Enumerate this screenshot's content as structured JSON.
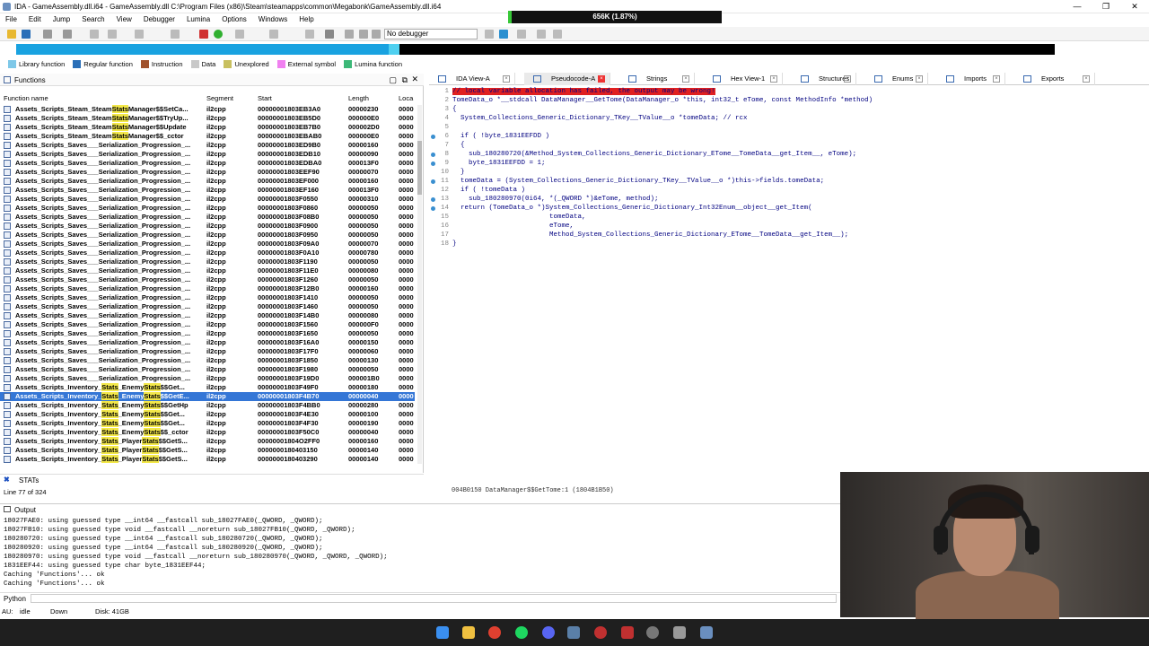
{
  "window": {
    "title": "IDA - GameAssembly.dll.i64 - GameAssembly.dll C:\\Program Files (x86)\\Steam\\steamapps\\common\\Megabonk\\GameAssembly.dll.i64",
    "progress": "656K (1.87%)",
    "progress_fraction": 0.0187
  },
  "menu": [
    "File",
    "Edit",
    "Jump",
    "Search",
    "View",
    "Debugger",
    "Lumina",
    "Options",
    "Windows",
    "Help"
  ],
  "toolbar": {
    "debugger": "No debugger"
  },
  "legend": [
    {
      "label": "Library function",
      "color": "#7ec8e8"
    },
    {
      "label": "Regular function",
      "color": "#2a6fb8"
    },
    {
      "label": "Instruction",
      "color": "#a0522d"
    },
    {
      "label": "Data",
      "color": "#c8c8c8"
    },
    {
      "label": "Unexplored",
      "color": "#c8c060"
    },
    {
      "label": "External symbol",
      "color": "#f080f0"
    },
    {
      "label": "Lumina function",
      "color": "#3cb878"
    }
  ],
  "functions_pane": {
    "title": "Functions",
    "columns": [
      "Function name",
      "Segment",
      "Start",
      "Length",
      "Loca"
    ],
    "rows": [
      [
        "Assets_Scripts_Steam_SteamStatsManager$$SetCa...",
        "il2cpp",
        "00000001803EB3A0",
        "00000230",
        "0000"
      ],
      [
        "Assets_Scripts_Steam_SteamStatsManager$$TryUp...",
        "il2cpp",
        "00000001803EB5D0",
        "000000E0",
        "0000"
      ],
      [
        "Assets_Scripts_Steam_SteamStatsManager$$Update",
        "il2cpp",
        "00000001803EB7B0",
        "000002D0",
        "0000"
      ],
      [
        "Assets_Scripts_Steam_SteamStatsManager$$_cctor",
        "il2cpp",
        "00000001803EBAB0",
        "000000E0",
        "0000"
      ],
      [
        "Assets_Scripts_Saves___Serialization_Progression_...",
        "il2cpp",
        "00000001803ED9B0",
        "00000160",
        "0000"
      ],
      [
        "Assets_Scripts_Saves___Serialization_Progression_...",
        "il2cpp",
        "00000001803EDB10",
        "00000090",
        "0000"
      ],
      [
        "Assets_Scripts_Saves___Serialization_Progression_...",
        "il2cpp",
        "00000001803EDBA0",
        "000013F0",
        "0000"
      ],
      [
        "Assets_Scripts_Saves___Serialization_Progression_...",
        "il2cpp",
        "00000001803EEF90",
        "00000070",
        "0000"
      ],
      [
        "Assets_Scripts_Saves___Serialization_Progression_...",
        "il2cpp",
        "00000001803EF000",
        "00000160",
        "0000"
      ],
      [
        "Assets_Scripts_Saves___Serialization_Progression_...",
        "il2cpp",
        "00000001803EF160",
        "000013F0",
        "0000"
      ],
      [
        "Assets_Scripts_Saves___Serialization_Progression_...",
        "il2cpp",
        "00000001803F0550",
        "00000310",
        "0000"
      ],
      [
        "Assets_Scripts_Saves___Serialization_Progression_...",
        "il2cpp",
        "00000001803F0860",
        "00000050",
        "0000"
      ],
      [
        "Assets_Scripts_Saves___Serialization_Progression_...",
        "il2cpp",
        "00000001803F08B0",
        "00000050",
        "0000"
      ],
      [
        "Assets_Scripts_Saves___Serialization_Progression_...",
        "il2cpp",
        "00000001803F0900",
        "00000050",
        "0000"
      ],
      [
        "Assets_Scripts_Saves___Serialization_Progression_...",
        "il2cpp",
        "00000001803F0950",
        "00000050",
        "0000"
      ],
      [
        "Assets_Scripts_Saves___Serialization_Progression_...",
        "il2cpp",
        "00000001803F09A0",
        "00000070",
        "0000"
      ],
      [
        "Assets_Scripts_Saves___Serialization_Progression_...",
        "il2cpp",
        "00000001803F0A10",
        "00000780",
        "0000"
      ],
      [
        "Assets_Scripts_Saves___Serialization_Progression_...",
        "il2cpp",
        "00000001803F1190",
        "00000050",
        "0000"
      ],
      [
        "Assets_Scripts_Saves___Serialization_Progression_...",
        "il2cpp",
        "00000001803F11E0",
        "00000080",
        "0000"
      ],
      [
        "Assets_Scripts_Saves___Serialization_Progression_...",
        "il2cpp",
        "00000001803F1260",
        "00000050",
        "0000"
      ],
      [
        "Assets_Scripts_Saves___Serialization_Progression_...",
        "il2cpp",
        "00000001803F12B0",
        "00000160",
        "0000"
      ],
      [
        "Assets_Scripts_Saves___Serialization_Progression_...",
        "il2cpp",
        "00000001803F1410",
        "00000050",
        "0000"
      ],
      [
        "Assets_Scripts_Saves___Serialization_Progression_...",
        "il2cpp",
        "00000001803F1460",
        "00000050",
        "0000"
      ],
      [
        "Assets_Scripts_Saves___Serialization_Progression_...",
        "il2cpp",
        "00000001803F14B0",
        "00000080",
        "0000"
      ],
      [
        "Assets_Scripts_Saves___Serialization_Progression_...",
        "il2cpp",
        "00000001803F1560",
        "000000F0",
        "0000"
      ],
      [
        "Assets_Scripts_Saves___Serialization_Progression_...",
        "il2cpp",
        "00000001803F1650",
        "00000050",
        "0000"
      ],
      [
        "Assets_Scripts_Saves___Serialization_Progression_...",
        "il2cpp",
        "00000001803F16A0",
        "00000150",
        "0000"
      ],
      [
        "Assets_Scripts_Saves___Serialization_Progression_...",
        "il2cpp",
        "00000001803F17F0",
        "00000060",
        "0000"
      ],
      [
        "Assets_Scripts_Saves___Serialization_Progression_...",
        "il2cpp",
        "00000001803F1850",
        "00000130",
        "0000"
      ],
      [
        "Assets_Scripts_Saves___Serialization_Progression_...",
        "il2cpp",
        "00000001803F1980",
        "00000050",
        "0000"
      ],
      [
        "Assets_Scripts_Saves___Serialization_Progression_...",
        "il2cpp",
        "00000001803F19D0",
        "000001B0",
        "0000"
      ],
      [
        "Assets_Scripts_Inventory_Stats_EnemyStats$$Get...",
        "il2cpp",
        "00000001803F49F0",
        "00000180",
        "0000"
      ],
      [
        "Assets_Scripts_Inventory_Stats_EnemyStats$$GetE...",
        "il2cpp",
        "00000001803F4B70",
        "00000040",
        "0000"
      ],
      [
        "Assets_Scripts_Inventory_Stats_EnemyStats$$GetHp",
        "il2cpp",
        "00000001803F4BB0",
        "00000280",
        "0000"
      ],
      [
        "Assets_Scripts_Inventory_Stats_EnemyStats$$Get...",
        "il2cpp",
        "00000001803F4E30",
        "00000100",
        "0000"
      ],
      [
        "Assets_Scripts_Inventory_Stats_EnemyStats$$Get...",
        "il2cpp",
        "00000001803F4F30",
        "00000190",
        "0000"
      ],
      [
        "Assets_Scripts_Inventory_Stats_EnemyStats$$_cctor",
        "il2cpp",
        "00000001803F50C0",
        "00000040",
        "0000"
      ],
      [
        "Assets_Scripts_Inventory_Stats_PlayerStats$$GetS...",
        "il2cpp",
        "00000001804O2FF0",
        "00000160",
        "0000"
      ],
      [
        "Assets_Scripts_Inventory_Stats_PlayerStats$$GetS...",
        "il2cpp",
        "0000000180403150",
        "00000140",
        "0000"
      ],
      [
        "Assets_Scripts_Inventory_Stats_PlayerStats$$GetS...",
        "il2cpp",
        "0000000180403290",
        "00000140",
        "0000"
      ]
    ],
    "selected_index": 32,
    "filter": "STATs",
    "line_status": "Line 77 of 324"
  },
  "tabs": [
    {
      "label": "IDA View-A",
      "active": false
    },
    {
      "label": "Pseudocode-A",
      "active": true
    },
    {
      "label": "Strings",
      "active": false
    },
    {
      "label": "Hex View-1",
      "active": false
    },
    {
      "label": "Structures",
      "active": false
    },
    {
      "label": "Enums",
      "active": false
    },
    {
      "label": "Imports",
      "active": false
    },
    {
      "label": "Exports",
      "active": false
    }
  ],
  "code": {
    "lines": [
      {
        "n": "1",
        "t": "// local variable allocation has failed, the output may be wrong!"
      },
      {
        "n": "2",
        "t": "TomeData_o *__stdcall DataManager__GetTome(DataManager_o *this, int32_t eTome, const MethodInfo *method)"
      },
      {
        "n": "3",
        "t": "{"
      },
      {
        "n": "4",
        "t": "  System_Collections_Generic_Dictionary_TKey__TValue__o *tomeData; // rcx"
      },
      {
        "n": "5",
        "t": ""
      },
      {
        "n": "6",
        "t": "  if ( !byte_1831EEFDD )"
      },
      {
        "n": "7",
        "t": "  {"
      },
      {
        "n": "8",
        "t": "    sub_180280720(&Method_System_Collections_Generic_Dictionary_ETome__TomeData__get_Item__, eTome);"
      },
      {
        "n": "9",
        "t": "    byte_1831EEFDD = 1;"
      },
      {
        "n": "10",
        "t": "  }"
      },
      {
        "n": "11",
        "t": "  tomeData = (System_Collections_Generic_Dictionary_TKey__TValue__o *)this->fields.tomeData;"
      },
      {
        "n": "12",
        "t": "  if ( !tomeData )"
      },
      {
        "n": "13",
        "t": "    sub_180280970(0i64, *(_QWORD *)&eTome, method);"
      },
      {
        "n": "14",
        "t": "  return (TomeData_o *)System_Collections_Generic_Dictionary_Int32Enum__object__get_Item("
      },
      {
        "n": "15",
        "t": "                        tomeData,"
      },
      {
        "n": "16",
        "t": "                        eTome,"
      },
      {
        "n": "17",
        "t": "                        Method_System_Collections_Generic_Dictionary_ETome__TomeData__get_Item__);"
      },
      {
        "n": "18",
        "t": "}"
      }
    ],
    "address": "004B0150 DataManager$$GetTome:1 (1804B1B50)"
  },
  "output": {
    "title": "Output",
    "lines": [
      "18027FAE0: using guessed type __int64 __fastcall sub_18027FAE0(_QWORD, _QWORD);",
      "18027FB10: using guessed type void __fastcall __noreturn sub_18027FB10(_QWORD, _QWORD);",
      "180280720: using guessed type __int64 __fastcall sub_180280720(_QWORD, _QWORD);",
      "180280920: using guessed type __int64 __fastcall sub_180280920(_QWORD, _QWORD);",
      "180280970: using guessed type void __fastcall __noreturn sub_180280970(_QWORD, _QWORD, _QWORD);",
      "1831EEF44: using guessed type char byte_1831EEF44;",
      "Caching 'Functions'... ok",
      "Caching 'Functions'... ok"
    ],
    "prompt": "Python"
  },
  "status": {
    "au": "AU:",
    "state": "idle",
    "dir": "Down",
    "disk": "Disk: 41GB"
  }
}
